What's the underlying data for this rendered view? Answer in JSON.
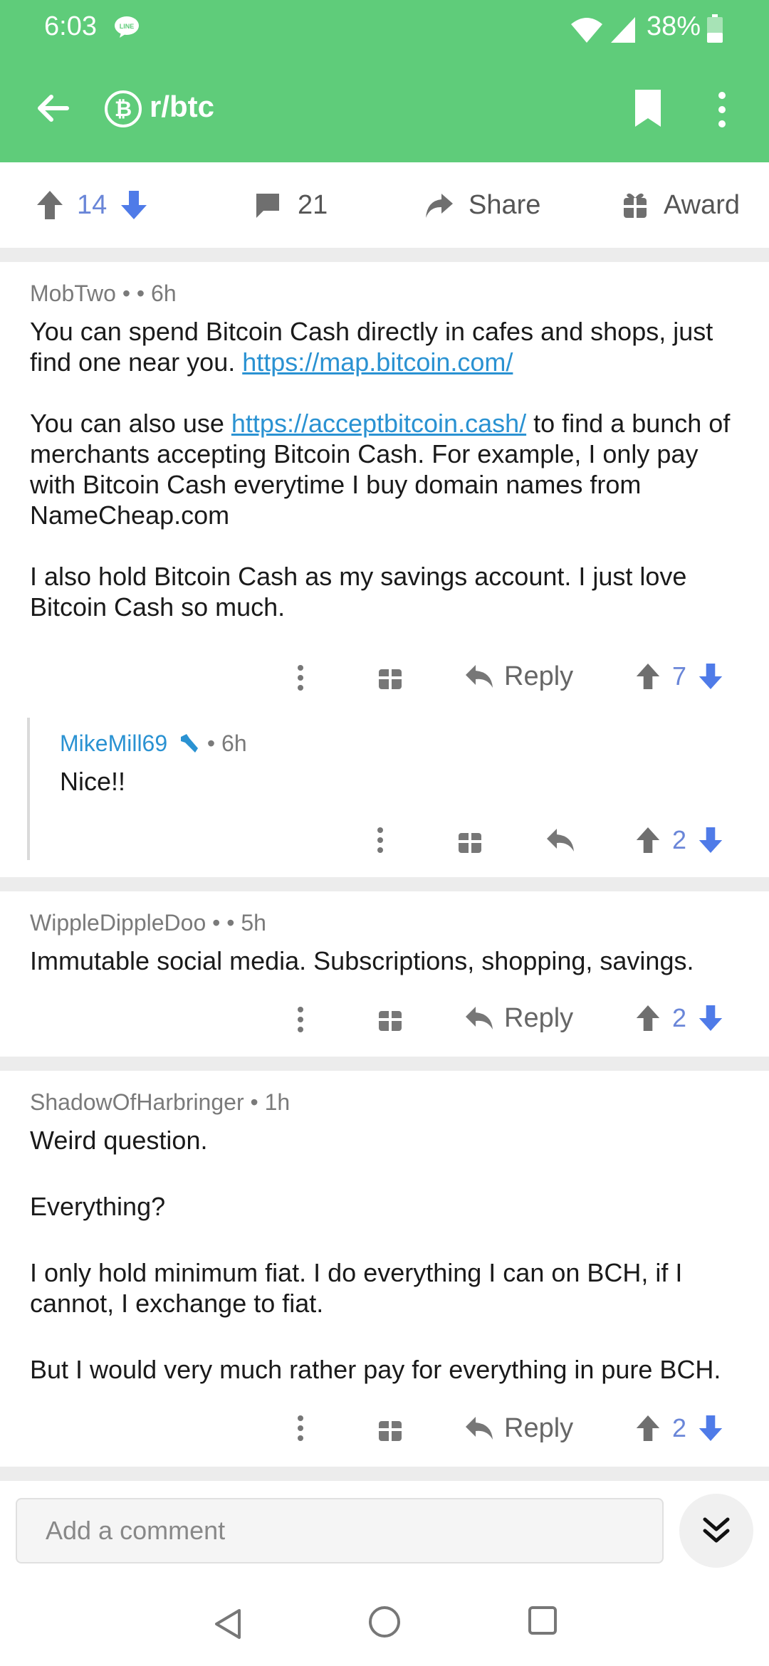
{
  "status_bar": {
    "time": "6:03",
    "battery": "38%",
    "icons": [
      "line-app-icon",
      "wifi-icon",
      "signal-icon",
      "battery-icon"
    ]
  },
  "header": {
    "subreddit": "r/btc",
    "icons": [
      "back-arrow-icon",
      "bitcoin-icon",
      "bookmark-icon",
      "more-vertical-icon"
    ]
  },
  "post_actions": {
    "score": "14",
    "comments": "21",
    "share_label": "Share",
    "award_label": "Award"
  },
  "comments": [
    {
      "author": "MobTwo",
      "meta_sep": "• • 6h",
      "p1_text": "You can spend Bitcoin Cash directly in cafes and shops, just find one near you. ",
      "p1_link": "https://map.bitcoin.com/",
      "p2_before": "You can also use ",
      "p2_link": "https://acceptbitcoin.cash/",
      "p2_after": " to find a bunch of merchants accepting Bitcoin Cash. For example, I only pay with Bitcoin Cash everytime I buy domain names from NameCheap.com",
      "p3": "I also hold Bitcoin Cash as my savings account. I just love Bitcoin Cash so much.",
      "reply_label": "Reply",
      "score": "7"
    },
    {
      "author": "MikeMill69",
      "meta_sep": "• 6h",
      "text": "Nice!!",
      "score": "2"
    },
    {
      "author": "WippleDippleDoo",
      "meta_sep": "• • 5h",
      "text": "Immutable social media. Subscriptions, shopping, savings.",
      "reply_label": "Reply",
      "score": "2"
    },
    {
      "author": "ShadowOfHarbringer",
      "meta_sep": "• 1h",
      "p1": "Weird question.",
      "p2": "Everything?",
      "p3": "I only hold minimum fiat. I do everything I can on BCH, if I cannot, I exchange to fiat.",
      "p4": "But I would very much rather pay for everything in pure BCH.",
      "reply_label": "Reply",
      "score": "2"
    }
  ],
  "composer": {
    "placeholder": "Add a comment"
  },
  "colors": {
    "appbar": "#5fcc7a",
    "link": "#2a92d2",
    "vote": "#6a86d8"
  }
}
